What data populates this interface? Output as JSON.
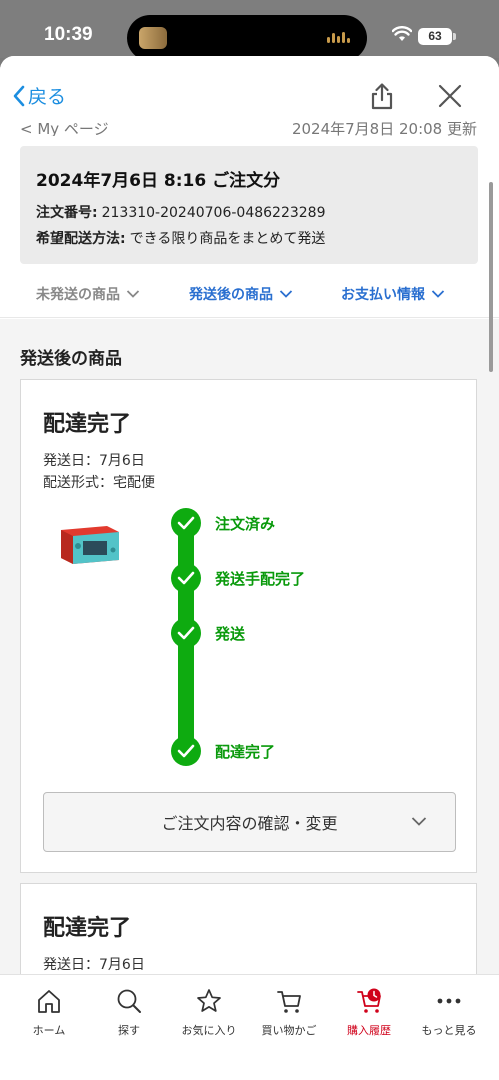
{
  "status_bar": {
    "time": "10:39",
    "battery": "63"
  },
  "nav": {
    "back_label": "戻る",
    "peek_left": "< My ページ",
    "peek_right": "2024年7月8日 20:08 更新"
  },
  "order": {
    "title": "2024年7月6日 8:16 ご注文分",
    "number_label": "注文番号:",
    "number_value": "213310-20240706-0486223289",
    "method_label": "希望配送方法:",
    "method_value": "できる限り商品をまとめて発送"
  },
  "tabs": [
    {
      "label": "未発送の商品"
    },
    {
      "label": "発送後の商品"
    },
    {
      "label": "お支払い情報"
    }
  ],
  "section_heading": "発送後の商品",
  "shipments": [
    {
      "status": "配達完了",
      "ship_date": "発送日：7月6日",
      "ship_method": "配送形式：宅配便",
      "steps": [
        "注文済み",
        "発送手配完了",
        "発送",
        "配達完了"
      ],
      "confirm_label": "ご注文内容の確認・変更"
    },
    {
      "status": "配達完了",
      "ship_date": "発送日：7月6日"
    }
  ],
  "bottom_nav": [
    {
      "label": "ホーム",
      "icon": "home-icon"
    },
    {
      "label": "探す",
      "icon": "search-icon"
    },
    {
      "label": "お気に入り",
      "icon": "star-icon"
    },
    {
      "label": "買い物かご",
      "icon": "cart-icon"
    },
    {
      "label": "購入履歴",
      "icon": "purchase-history-icon",
      "active": true
    },
    {
      "label": "もっと見る",
      "icon": "more-icon"
    }
  ],
  "colors": {
    "accent_blue": "#1c8ee0",
    "tab_blue": "#2a6fd0",
    "progress_green": "#0eab10",
    "active_red": "#d0021b"
  }
}
